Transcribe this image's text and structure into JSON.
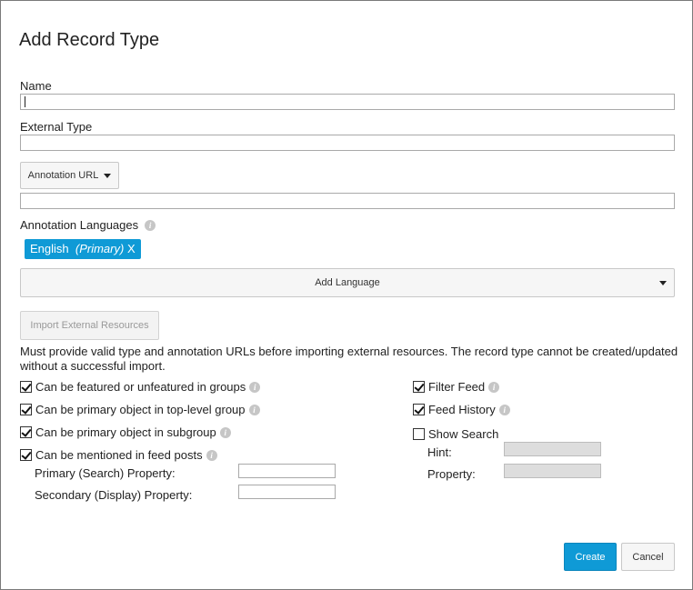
{
  "dialog": {
    "title": "Add Record Type",
    "fields": {
      "name_label": "Name",
      "name_value": "",
      "external_type_label": "External Type",
      "external_type_value": "",
      "annotation_url_dropdown": "Annotation URL",
      "annotation_url_value": ""
    },
    "languages": {
      "label": "Annotation Languages",
      "selected": [
        {
          "name": "English",
          "tag": "(Primary)",
          "remove": "X"
        }
      ],
      "add_button": "Add Language"
    },
    "import": {
      "button": "Import External Resources",
      "help_text": "Must provide valid type and annotation URLs before importing external resources. The record type cannot be created/updated without a successful import."
    },
    "options_left": [
      {
        "label": "Can be featured or unfeatured in groups",
        "checked": true,
        "info": true
      },
      {
        "label": "Can be primary object in top-level group",
        "checked": true,
        "info": true
      },
      {
        "label": "Can be primary object in subgroup",
        "checked": true,
        "info": true
      },
      {
        "label": "Can be mentioned in feed posts",
        "checked": true,
        "info": true
      }
    ],
    "mention_properties": {
      "primary_label": "Primary (Search) Property:",
      "primary_value": "",
      "secondary_label": "Secondary (Display) Property:",
      "secondary_value": ""
    },
    "options_right": [
      {
        "label": "Filter Feed",
        "checked": true,
        "info": true
      },
      {
        "label": "Feed History",
        "checked": true,
        "info": true
      },
      {
        "label": "Show Search",
        "checked": false,
        "info": false
      }
    ],
    "search_properties": {
      "hint_label": "Hint:",
      "hint_value": "",
      "property_label": "Property:",
      "property_value": ""
    },
    "actions": {
      "create": "Create",
      "cancel": "Cancel"
    },
    "colors": {
      "accent": "#0f9ad6",
      "border": "#a9a9a9",
      "disabled_input": "#dddddd"
    }
  }
}
